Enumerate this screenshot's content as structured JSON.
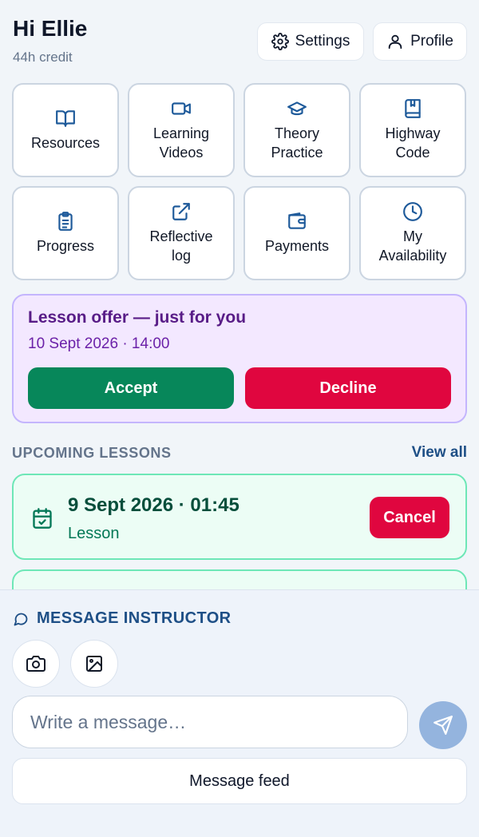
{
  "header": {
    "greeting": "Hi Ellie",
    "credit": "44h credit",
    "settings_label": "Settings",
    "settings_icon": "gear-icon",
    "profile_label": "Profile",
    "profile_icon": "user-icon"
  },
  "tiles": [
    {
      "label_line1": "Resources",
      "label_line2": "",
      "icon": "book-open-icon"
    },
    {
      "label_line1": "Learning",
      "label_line2": "Videos",
      "icon": "video-camera-icon"
    },
    {
      "label_line1": "Theory",
      "label_line2": "Practice",
      "icon": "graduation-cap-icon"
    },
    {
      "label_line1": "Highway",
      "label_line2": "Code",
      "icon": "book-bookmark-icon"
    },
    {
      "label_line1": "Progress",
      "label_line2": "",
      "icon": "clipboard-list-icon"
    },
    {
      "label_line1": "Reflective",
      "label_line2": "log",
      "icon": "external-link-icon"
    },
    {
      "label_line1": "Payments",
      "label_line2": "",
      "icon": "wallet-icon"
    },
    {
      "label_line1": "My",
      "label_line2": "Availability",
      "icon": "clock-icon"
    }
  ],
  "offer": {
    "title": "Lesson offer — just for you",
    "datetime": "10 Sept 2026 · 14:00",
    "accept_label": "Accept",
    "decline_label": "Decline"
  },
  "upcoming": {
    "section_title": "UPCOMING LESSONS",
    "view_all_label": "View all",
    "lessons": [
      {
        "datetime": "9 Sept 2026 · 01:45",
        "type": "Lesson",
        "cancel_label": "Cancel",
        "icon": "calendar-check-icon"
      }
    ]
  },
  "composer": {
    "title": "MESSAGE INSTRUCTOR",
    "title_icon": "chat-bubble-icon",
    "camera_icon": "camera-icon",
    "image_icon": "image-icon",
    "input_placeholder": "Write a message…",
    "input_value": "",
    "send_icon": "send-icon",
    "feed_label": "Message feed"
  },
  "colors": {
    "brand": "#1e4f86",
    "accept": "#07875a",
    "decline": "#e0063f",
    "offer_bg": "#f3e8ff",
    "lesson_bg": "#ecfdf5"
  }
}
